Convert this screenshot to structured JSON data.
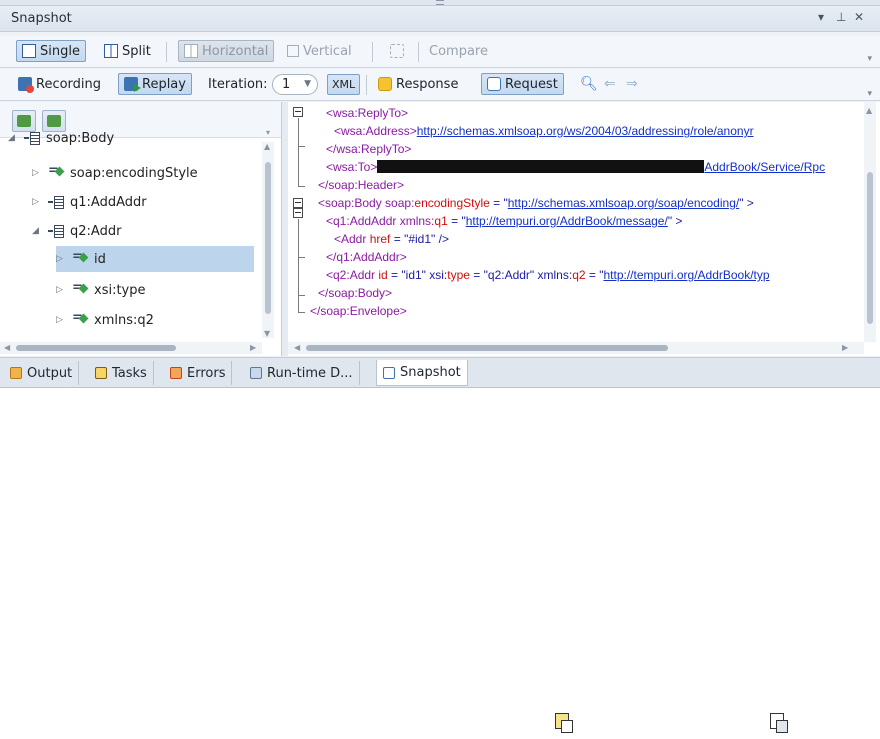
{
  "panel": {
    "title": "Snapshot",
    "controls": {
      "dropdown": "▾",
      "pin": "⊥",
      "close": "✕"
    }
  },
  "toolbar1": {
    "single": "Single",
    "split": "Split",
    "horizontal": "Horizontal",
    "vertical": "Vertical",
    "compare": "Compare"
  },
  "toolbar2": {
    "recording": "Recording",
    "replay": "Replay",
    "iteration_label": "Iteration:",
    "iteration_value": "1",
    "xml": "XML",
    "response": "Response",
    "request": "Request"
  },
  "tree": {
    "nodes": [
      {
        "label": "soap:Body",
        "icon": "element-icon"
      },
      {
        "label": "soap:encodingStyle",
        "icon": "attribute-icon"
      },
      {
        "label": "q1:AddAddr",
        "icon": "element-icon"
      },
      {
        "label": "q2:Addr",
        "icon": "element-icon"
      },
      {
        "label": "id",
        "icon": "attribute-icon",
        "selected": true
      },
      {
        "label": "xsi:type",
        "icon": "attribute-icon"
      },
      {
        "label": "xmlns:q2",
        "icon": "attribute-icon"
      }
    ]
  },
  "xml": {
    "l1_tag": "<wsa:ReplyTo>",
    "l2_tag": "<wsa:Address>",
    "l2_link": "http://schemas.xmlsoap.org/ws/2004/03/addressing/role/anonyr",
    "l3_tag": "</wsa:ReplyTo>",
    "l4_tag": "<wsa:To>",
    "l4_link": "AddrBook/Service/Rpc",
    "l5_tag": "</soap:Header>",
    "l6_tag": "<soap:Body soap:",
    "l6_attr": "encodingStyle",
    "l6_eq": " = \"",
    "l6_link": "http://schemas.xmlsoap.org/soap/encoding/",
    "l6_end": "\" >",
    "l7_tag": "<q1:AddAddr xmlns:",
    "l7_attr": "q1",
    "l7_eq": " = \"",
    "l7_link": "http://tempuri.org/AddrBook/message/",
    "l7_end": "\" >",
    "l8_tag": "<Addr ",
    "l8_attr": "href",
    "l8_rest": " = \"#id1\" />",
    "l9_tag": "</q1:AddAddr>",
    "l10_tag": "<q2:Addr ",
    "l10_attr1": "id",
    "l10_mid1": " = \"id1\" xsi:",
    "l10_attr2": "type",
    "l10_mid2": " = \"q2:Addr\" xmlns:",
    "l10_attr3": "q2",
    "l10_mid3": " = \"",
    "l10_link": "http://tempuri.org/AddrBook/typ",
    "l11_tag": "</soap:Body>",
    "l12_tag": "</soap:Envelope>"
  },
  "tabs": [
    {
      "label": "Output"
    },
    {
      "label": "Tasks"
    },
    {
      "label": "Errors"
    },
    {
      "label": "Run-time D..."
    },
    {
      "label": "Snapshot",
      "active": true
    }
  ]
}
